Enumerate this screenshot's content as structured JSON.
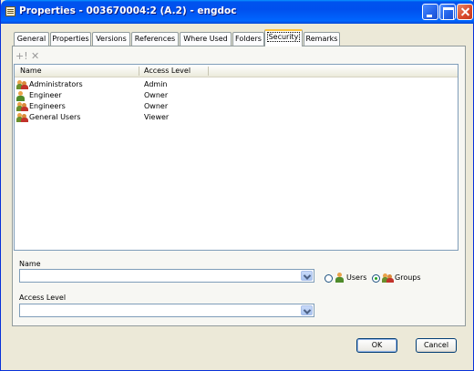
{
  "window": {
    "title": "Properties - 003670004:2 (A.2) - engdoc"
  },
  "tabs": [
    {
      "label": "General"
    },
    {
      "label": "Properties"
    },
    {
      "label": "Versions"
    },
    {
      "label": "References"
    },
    {
      "label": "Where Used"
    },
    {
      "label": "Folders"
    },
    {
      "label": "Security",
      "active": true
    },
    {
      "label": "Remarks"
    }
  ],
  "toolbar": {
    "add_icon": "add-icon",
    "add_glyph": "+!",
    "remove_icon": "remove-icon",
    "remove_glyph": "✕"
  },
  "list": {
    "columns": [
      "Name",
      "Access Level"
    ],
    "rows": [
      {
        "icon": "group-icon",
        "name": "Administrators",
        "access": "Admin"
      },
      {
        "icon": "user-icon",
        "name": "Engineer",
        "access": "Owner"
      },
      {
        "icon": "group-icon",
        "name": "Engineers",
        "access": "Owner"
      },
      {
        "icon": "group-icon",
        "name": "General Users",
        "access": "Viewer"
      }
    ]
  },
  "form": {
    "name_label": "Name",
    "name_value": "",
    "users_label": "Users",
    "groups_label": "Groups",
    "selected_radio": "Groups",
    "access_label": "Access Level",
    "access_value": ""
  },
  "buttons": {
    "ok": "OK",
    "cancel": "Cancel"
  }
}
